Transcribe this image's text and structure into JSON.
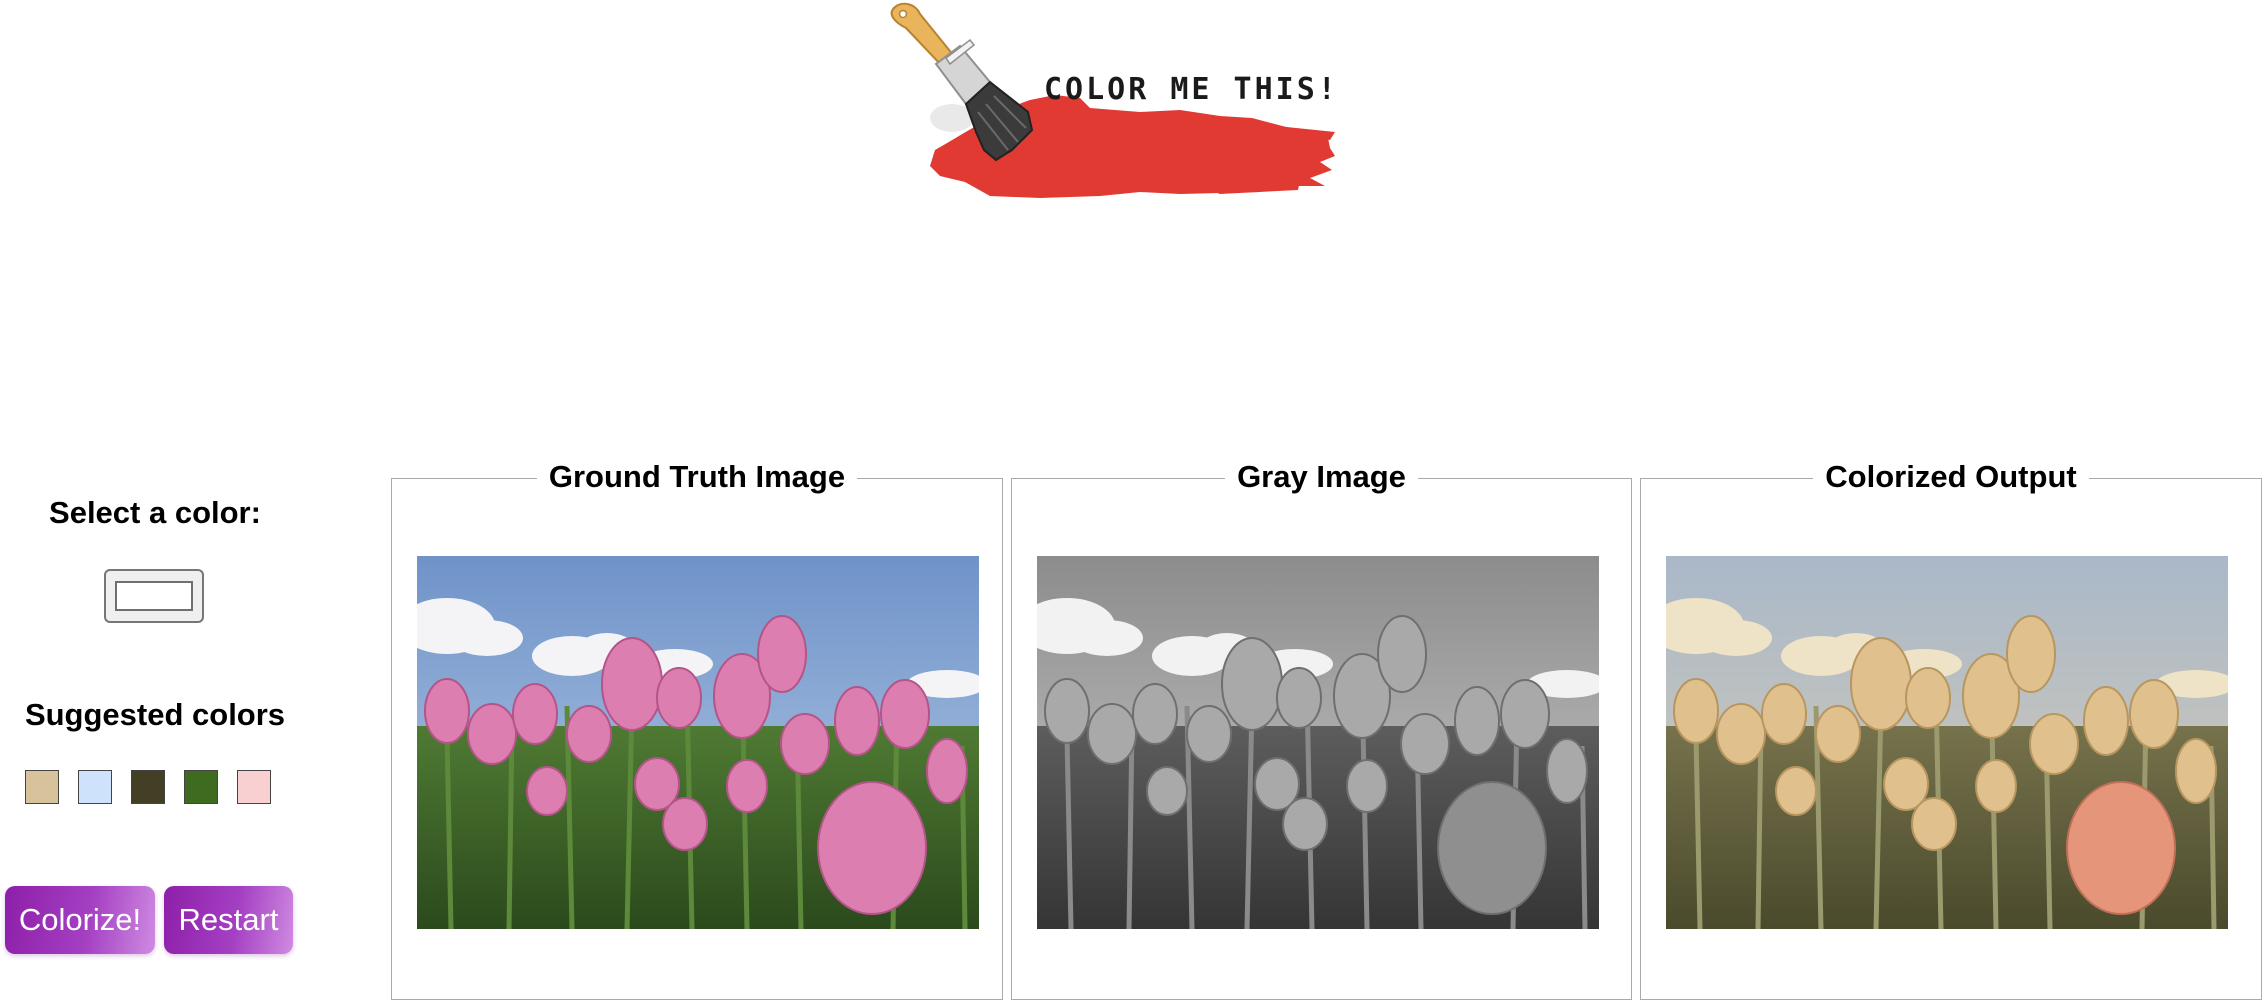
{
  "header": {
    "logo_text": "COLOR ME THIS!",
    "logo_icon": "paintbrush-icon",
    "logo_paint_color": "#e03a33"
  },
  "sidebar": {
    "select_heading": "Select a color:",
    "picker_value": "#ffffff",
    "suggested_heading": "Suggested colors",
    "suggested_colors": [
      "#d8c29c",
      "#cfe2fb",
      "#433f27",
      "#3e6b20",
      "#f9d0d2"
    ],
    "colorize_label": "Colorize!",
    "restart_label": "Restart",
    "button_color": "#9b2fb8"
  },
  "panels": {
    "ground_truth_title": "Ground Truth Image",
    "gray_title": "Gray Image",
    "colorized_title": "Colorized Output"
  }
}
